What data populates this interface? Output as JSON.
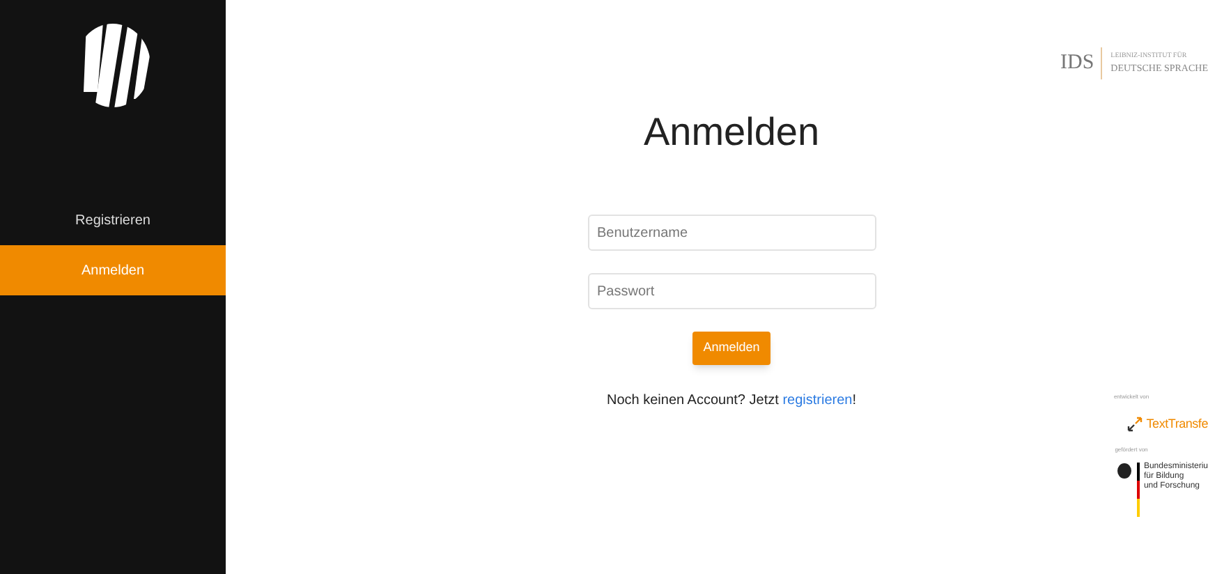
{
  "sidebar": {
    "items": [
      {
        "label": "Registrieren",
        "selected": false
      },
      {
        "label": "Anmelden",
        "selected": true
      }
    ]
  },
  "header_logo": {
    "initials": "IDS",
    "line_1": "LEIBNIZ-INSTITUT FÜR",
    "line_2": "DEUTSCHE SPRACHE"
  },
  "title": "Anmelden",
  "form": {
    "username": {
      "placeholder": "Benutzername"
    },
    "password": {
      "placeholder": "Passwort"
    },
    "submit": "Anmelden"
  },
  "register_prompt": {
    "text": "Noch keinen Account? Jetzt",
    "link": "registrieren",
    "suffix": "!"
  },
  "sponsors": {
    "caption_1": "entwickelt von",
    "texttransfer": "TextTransfe",
    "caption_2": "gefördert von",
    "ministry": [
      "Bundesministeriu",
      "für Bildung",
      "und Forschung"
    ]
  }
}
